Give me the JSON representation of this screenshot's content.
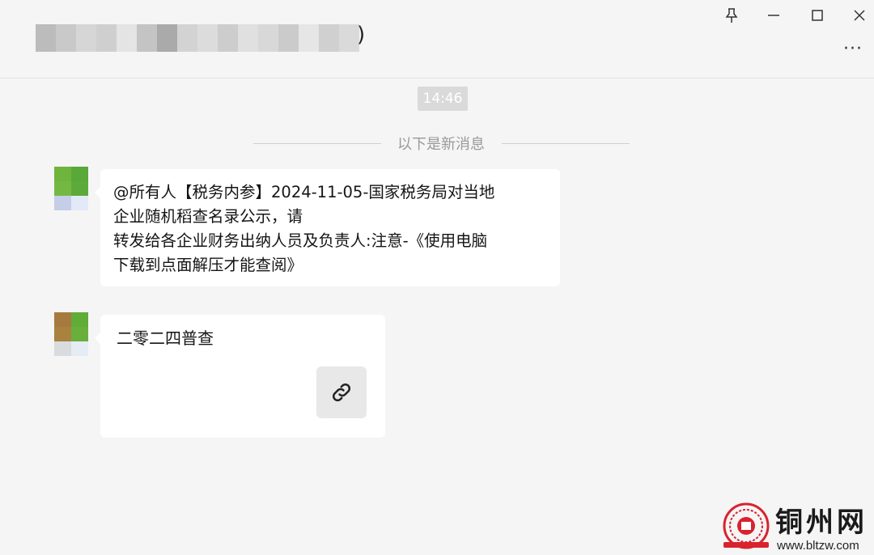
{
  "header": {
    "title_visible_suffix": ")",
    "window_controls": {
      "pin": "pin-icon",
      "minimize": "minimize-icon",
      "maximize": "maximize-icon",
      "close": "close-icon"
    },
    "more_label": "···"
  },
  "chat": {
    "timestamp": "14:46",
    "new_messages_divider": "以下是新消息",
    "messages": [
      {
        "type": "text",
        "lines": [
          "@所有人【税务内参】2024-11-05-国家税务局对当地",
          "企业随机稻查名录公示，请",
          "转发给各企业财务出纳人员及负责人:注意-《使用电脑",
          "下载到点面解压才能查阅》"
        ]
      },
      {
        "type": "link-card",
        "title": "二零二四普查",
        "icon": "link-icon"
      }
    ]
  },
  "watermark": {
    "name": "铜州网",
    "url": "www.bltzw.com"
  },
  "colors": {
    "background": "#f5f5f5",
    "bubble": "#ffffff",
    "timestamp_bg": "#dadada",
    "watermark_red": "#d9232d"
  }
}
